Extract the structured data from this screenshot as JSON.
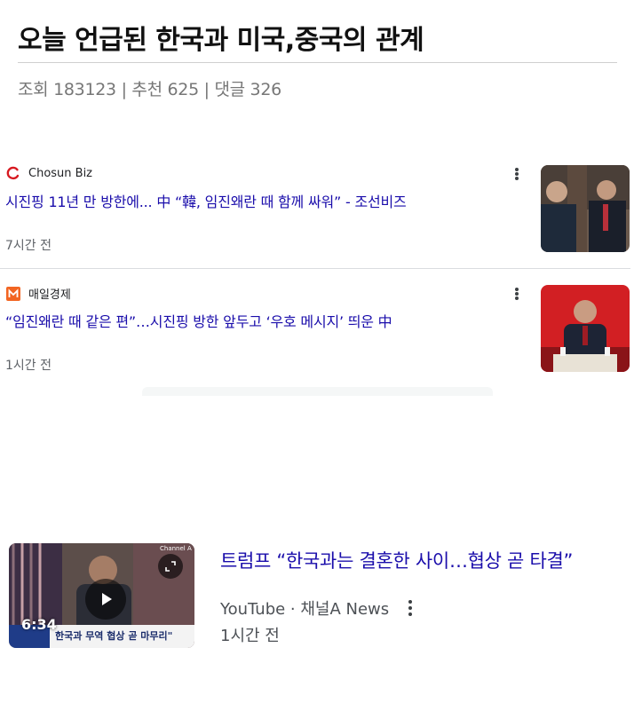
{
  "post": {
    "title": "오늘 언급된 한국과 미국,중국의 관계",
    "stats": "조회 183123 | 추천 625 | 댓글 326"
  },
  "news": [
    {
      "source": "Chosun Biz",
      "source_icon": "chosun-biz-logo",
      "headline": "시진핑 11년 만 방한에... 中 “韓, 임진왜란 때 함께 싸워” - 조선비즈",
      "age": "7시간 전",
      "thumbnail": "photo of officials seated at a meeting"
    },
    {
      "source": "매일경제",
      "source_icon": "maeil-kyungje-logo",
      "headline": "“임진왜란 때 같은 편”…시진핑 방한 앞두고 ‘우호 메시지’ 띄운 中",
      "age": "1시간 전",
      "thumbnail": "photo of a speaker at a podium with red backdrop"
    }
  ],
  "video": {
    "title": "트럼프 “한국과는 결혼한 사이…협상 곧 타결”",
    "source": "YouTube · 채널A News",
    "age": "1시간 전",
    "duration": "6:34",
    "thumb_caption": "한국과 무역 협상 곧 마무리\"",
    "thumb_channel": "Channel A"
  },
  "colors": {
    "link": "#1a0dab",
    "meta": "#5f6368",
    "title": "#111111",
    "stats": "#777777"
  }
}
